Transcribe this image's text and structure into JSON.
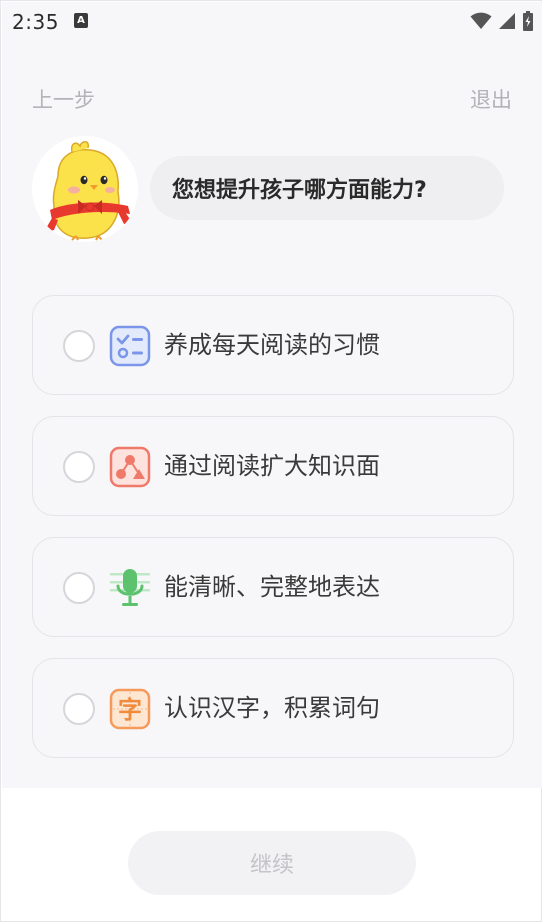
{
  "status_bar": {
    "time": "2:35",
    "notification_icon": "a-badge-icon",
    "a_letter": "A",
    "icons": [
      "wifi-icon",
      "cell-signal-icon",
      "battery-icon"
    ]
  },
  "nav": {
    "prev_label": "上一步",
    "exit_label": "退出"
  },
  "question": {
    "text": "您想提升孩子哪方面能力?"
  },
  "options": [
    {
      "label": "养成每天阅读的习惯",
      "icon": "checklist-icon",
      "color": "#7b95e8"
    },
    {
      "label": "通过阅读扩大知识面",
      "icon": "knowledge-nodes-icon",
      "color": "#f07a6a"
    },
    {
      "label": "能清晰、完整地表达",
      "icon": "microphone-icon",
      "color": "#5cc26e"
    },
    {
      "label": "认识汉字，积累词句",
      "icon": "character-icon",
      "color": "#f59a5a",
      "glyph": "字"
    }
  ],
  "footer": {
    "continue_label": "继续"
  },
  "colors": {
    "background": "#f7f7f9",
    "muted_text": "#b3b3b8",
    "mascot_yellow": "#fbe14a",
    "scarf_red": "#e8392f"
  }
}
